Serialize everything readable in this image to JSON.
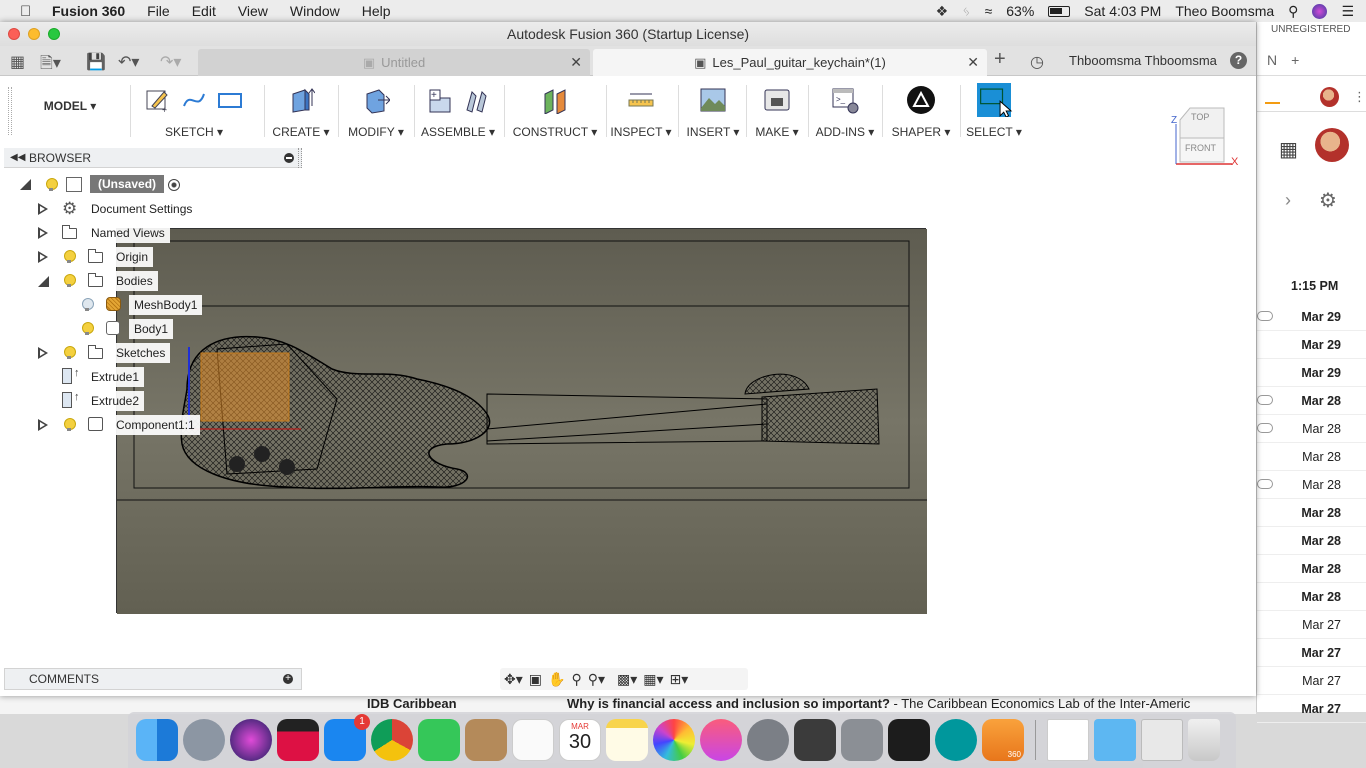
{
  "menubar": {
    "app": "Fusion 360",
    "items": [
      "File",
      "Edit",
      "View",
      "Window",
      "Help"
    ],
    "battery": "63%",
    "clock": "Sat 4:03 PM",
    "user": "Theo Boomsma"
  },
  "window": {
    "title": "Autodesk Fusion 360 (Startup License)",
    "tabs": [
      {
        "label": "Untitled",
        "active": false
      },
      {
        "label": "Les_Paul_guitar_keychain*(1)",
        "active": true
      }
    ],
    "user_name": "Thboomsma Thboomsma",
    "help": "?"
  },
  "toolbar": {
    "workspace": "MODEL ▾",
    "groups": [
      "SKETCH ▾",
      "CREATE ▾",
      "MODIFY ▾",
      "ASSEMBLE ▾",
      "CONSTRUCT ▾",
      "INSPECT ▾",
      "INSERT ▾",
      "MAKE ▾",
      "ADD-INS ▾",
      "SHAPER ▾",
      "SELECT ▾"
    ]
  },
  "viewcube": {
    "top": "TOP",
    "front": "FRONT",
    "x_axis": "X",
    "z_axis": "Z"
  },
  "browser": {
    "title": "BROWSER",
    "root": "(Unsaved)",
    "nodes": [
      {
        "label": "Document Settings",
        "icon": "gear-icon"
      },
      {
        "label": "Named Views",
        "icon": "folder-icon"
      },
      {
        "label": "Origin",
        "icon": "folder-icon"
      },
      {
        "label": "Bodies",
        "icon": "folder-icon"
      },
      {
        "label": "MeshBody1",
        "icon": "mesh-body-icon"
      },
      {
        "label": "Body1",
        "icon": "body-icon"
      },
      {
        "label": "Sketches",
        "icon": "folder-icon"
      },
      {
        "label": "Extrude1",
        "icon": "extrude-icon"
      },
      {
        "label": "Extrude2",
        "icon": "extrude-icon"
      },
      {
        "label": "Component1:1",
        "icon": "component-icon"
      }
    ]
  },
  "comments": {
    "title": "COMMENTS"
  },
  "background_app": {
    "unregistered": "UNREGISTERED",
    "time": "1:15 PM",
    "dates": [
      {
        "text": "Mar 29",
        "bold": true,
        "clip": true
      },
      {
        "text": "Mar 29",
        "bold": true,
        "clip": false
      },
      {
        "text": "Mar 29",
        "bold": true,
        "clip": false
      },
      {
        "text": "Mar 28",
        "bold": true,
        "clip": true
      },
      {
        "text": "Mar 28",
        "bold": false,
        "clip": true
      },
      {
        "text": "Mar 28",
        "bold": false,
        "clip": false
      },
      {
        "text": "Mar 28",
        "bold": false,
        "clip": true
      },
      {
        "text": "Mar 28",
        "bold": true,
        "clip": false
      },
      {
        "text": "Mar 28",
        "bold": true,
        "clip": false
      },
      {
        "text": "Mar 28",
        "bold": true,
        "clip": false
      },
      {
        "text": "Mar 28",
        "bold": true,
        "clip": false
      },
      {
        "text": "Mar 27",
        "bold": false,
        "clip": false
      },
      {
        "text": "Mar 27",
        "bold": true,
        "clip": false
      },
      {
        "text": "Mar 27",
        "bold": false,
        "clip": false
      },
      {
        "text": "Mar 27",
        "bold": true,
        "clip": false
      }
    ]
  },
  "underlay": {
    "sender": "IDB Caribbean",
    "subject_bold": "Why is financial access and inclusion so important?",
    "subject_rest": " - The Caribbean Economics Lab of the Inter-Americ"
  },
  "dock": {
    "calendar_month": "MAR",
    "calendar_day": "30",
    "appstore_badge": "1",
    "fusion_label": "360"
  }
}
